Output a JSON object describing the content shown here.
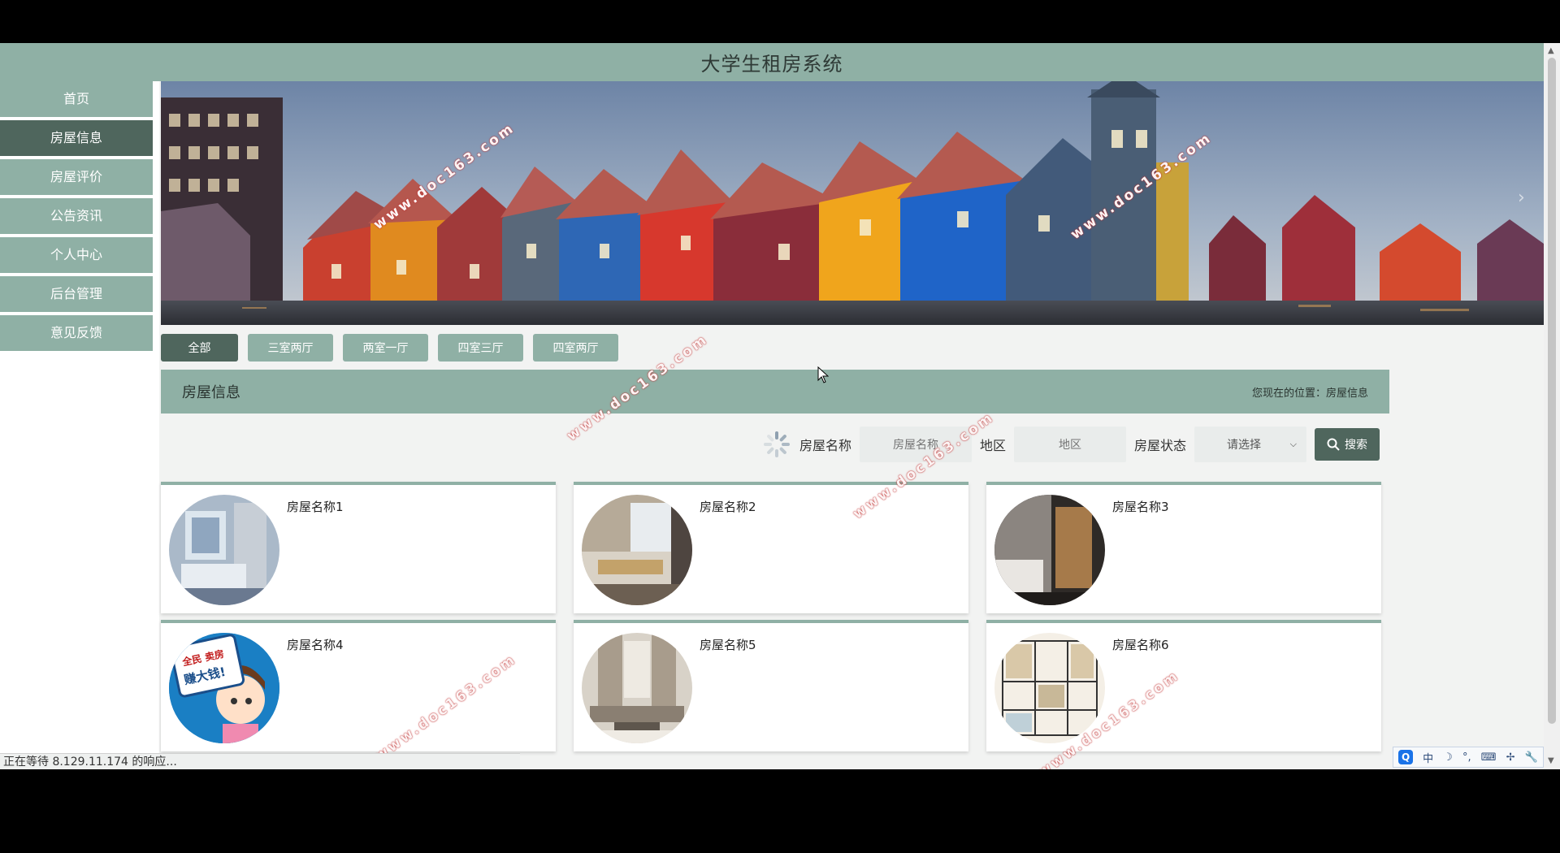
{
  "header": {
    "title": "大学生租房系统"
  },
  "sidebar": {
    "items": [
      {
        "label": "首页",
        "active": false
      },
      {
        "label": "房屋信息",
        "active": true
      },
      {
        "label": "房屋评价",
        "active": false
      },
      {
        "label": "公告资讯",
        "active": false
      },
      {
        "label": "个人中心",
        "active": false
      },
      {
        "label": "后台管理",
        "active": false
      },
      {
        "label": "意见反馈",
        "active": false
      }
    ]
  },
  "filters": [
    "全部",
    "三室两厅",
    "两室一厅",
    "四室三厅",
    "四室两厅"
  ],
  "section": {
    "title": "房屋信息",
    "breadcrumb": "您现在的位置：房屋信息"
  },
  "search": {
    "name_label": "房屋名称",
    "name_placeholder": "房屋名称",
    "area_label": "地区",
    "area_placeholder": "地区",
    "status_label": "房屋状态",
    "status_selected": "请选择",
    "button_label": "搜索"
  },
  "houses": [
    {
      "name": "房屋名称1",
      "photo": "bedroom-blue"
    },
    {
      "name": "房屋名称2",
      "photo": "bedroom-window"
    },
    {
      "name": "房屋名称3",
      "photo": "bedroom-dark"
    },
    {
      "name": "房屋名称4",
      "photo": "ad-cartoon",
      "badge": [
        "全民 卖房",
        "赚大钱!"
      ]
    },
    {
      "name": "房屋名称5",
      "photo": "living-room"
    },
    {
      "name": "房屋名称6",
      "photo": "floor-plan"
    }
  ],
  "status_bar": {
    "text": "正在等待 8.129.11.174 的响应..."
  },
  "ime": {
    "lang": "中"
  },
  "watermark": "www.doc163.com",
  "colors": {
    "accent": "#8fb0a5",
    "accent_dark": "#4f665d"
  }
}
